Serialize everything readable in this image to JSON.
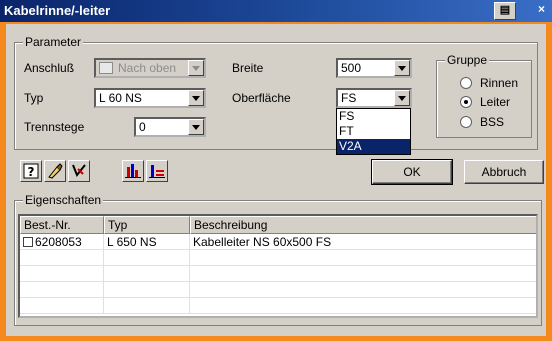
{
  "window": {
    "title": "Kabelrinne/-leiter"
  },
  "params": {
    "legend": "Parameter",
    "anschluss_label": "Anschluß",
    "anschluss_value": "Nach oben",
    "typ_label": "Typ",
    "typ_value": "L 60 NS",
    "trennstege_label": "Trennstege",
    "trennstege_value": "0",
    "breite_label": "Breite",
    "breite_value": "500",
    "oberflaeche_label": "Oberfläche",
    "oberflaeche_value": "FS",
    "oberflaeche_options": [
      "FS",
      "FT",
      "V2A"
    ]
  },
  "gruppe": {
    "legend": "Gruppe",
    "options": [
      "Rinnen",
      "Leiter",
      "BSS"
    ],
    "selected": "Leiter"
  },
  "buttons": {
    "ok": "OK",
    "abbruch": "Abbruch"
  },
  "eigenschaften": {
    "legend": "Eigenschaften",
    "columns": [
      "Best.-Nr.",
      "Typ",
      "Beschreibung"
    ],
    "rows": [
      {
        "nr": "6208053",
        "typ": "L 650 NS",
        "beschreibung": "Kabelleiter NS 60x500 FS"
      }
    ]
  },
  "colors": {
    "accent": "#f48a1e",
    "titlebar": "#0a246a",
    "face": "#d4d0c8"
  }
}
